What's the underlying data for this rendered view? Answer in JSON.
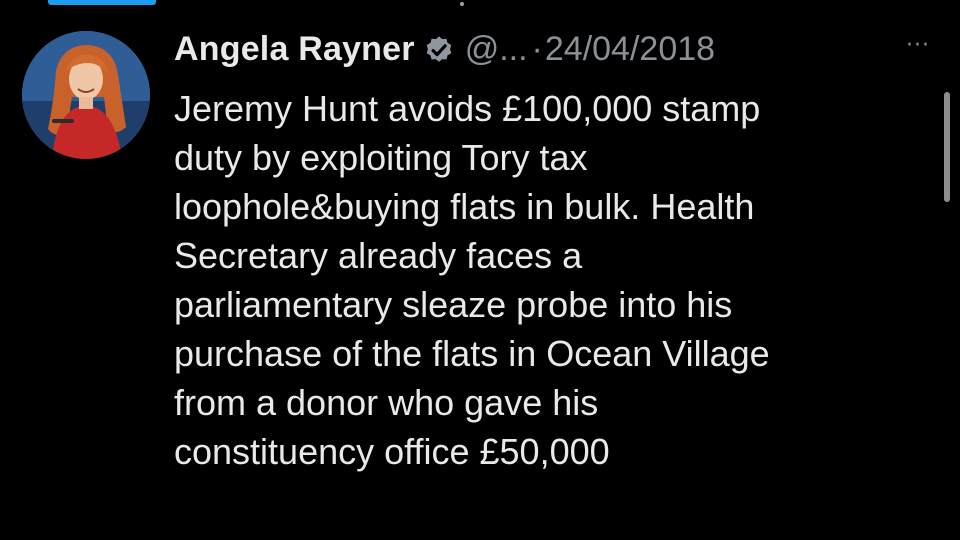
{
  "tweet": {
    "author_name": "Angela Rayner",
    "handle": "@...",
    "separator": "·",
    "date": "24/04/2018",
    "more_icon": "more-horizontal-icon",
    "more_label": "···",
    "verified_icon": "verified-badge-icon",
    "lines": [
      "Jeremy Hunt avoids £100,000 stamp",
      "duty by exploiting Tory tax",
      "loophole&buying flats in bulk. Health",
      "Secretary already faces a",
      "parliamentary sleaze probe into his",
      "purchase of the flats in Ocean Village",
      "from a donor who gave his",
      "constituency office £50,000"
    ]
  },
  "colors": {
    "background": "#000000",
    "text_primary": "#e7e9ea",
    "text_secondary": "#8b9096",
    "accent": "#1d9bf0"
  }
}
